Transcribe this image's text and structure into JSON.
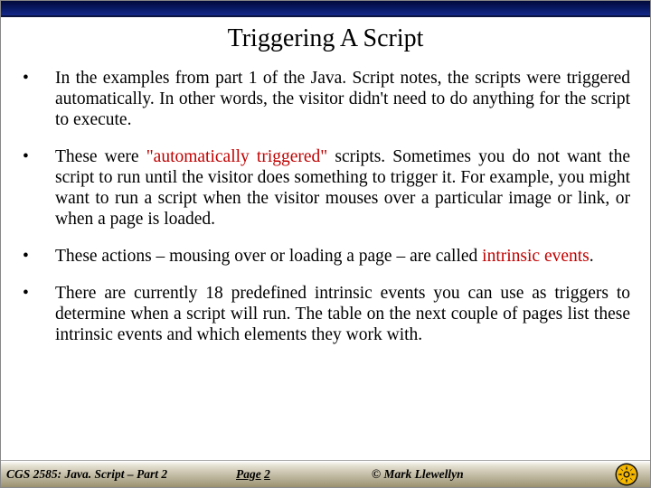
{
  "title": "Triggering A Script",
  "bullets": {
    "b1": "In the examples from part 1 of the Java. Script notes, the scripts were triggered automatically.  In other words, the visitor didn't need to do anything for the script to execute.",
    "b2a": "These were ",
    "b2quote": "\"automatically triggered\"",
    "b2b": " scripts.  Sometimes you do not want the script to run until the visitor does something to trigger it.  For example, you might want to run a script when the visitor mouses over a particular image or link, or when a page is loaded.",
    "b3a": "These actions – mousing over or loading a page – are called ",
    "b3intr": "intrinsic events",
    "b3b": ".",
    "b4": "There are currently 18 predefined intrinsic events you can use as triggers to determine when a script will run.  The table on the next couple of pages list these intrinsic events and which elements they work with."
  },
  "footer": {
    "course": "CGS 2585: Java. Script – Part 2",
    "page_label_prefix": "Page",
    "page_number": "2",
    "copyright": "© Mark Llewellyn"
  },
  "colors": {
    "accent_red": "#c00000"
  }
}
